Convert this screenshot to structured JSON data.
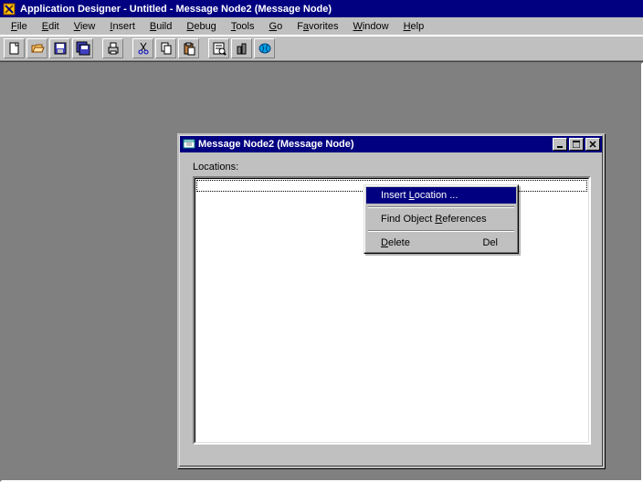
{
  "window": {
    "title": "Application Designer - Untitled - Message Node2 (Message Node)"
  },
  "menus": {
    "file": "File",
    "edit": "Edit",
    "view": "View",
    "insert": "Insert",
    "build": "Build",
    "debug": "Debug",
    "tools": "Tools",
    "go": "Go",
    "favorites": "Favorites",
    "window": "Window",
    "help": "Help"
  },
  "child": {
    "title": "Message Node2 (Message Node)",
    "field_label": "Locations:"
  },
  "context_menu": {
    "insert_location": "Insert Location ...",
    "find_refs": "Find Object References",
    "delete": "Delete",
    "delete_shortcut": "Del"
  }
}
